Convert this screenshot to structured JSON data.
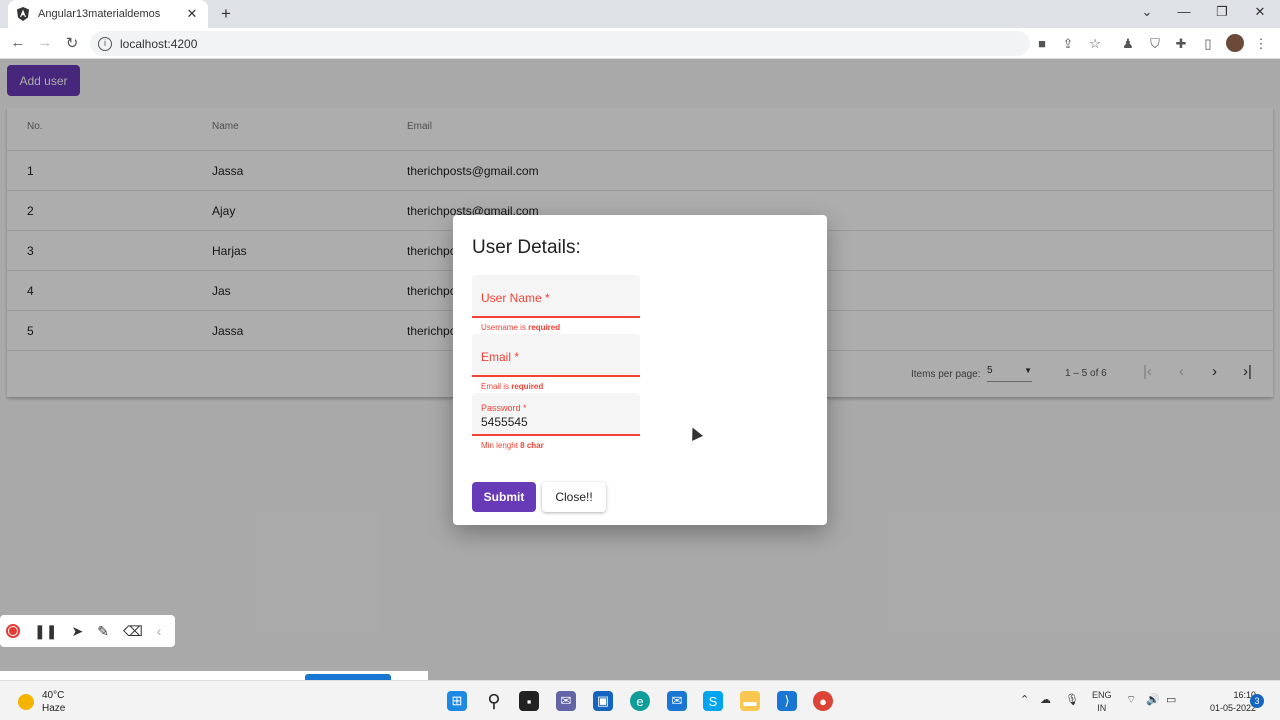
{
  "browser": {
    "tab_title": "Angular13materialdemos",
    "url": "localhost:4200"
  },
  "page": {
    "add_user_label": "Add user",
    "columns": [
      "No.",
      "Name",
      "Email"
    ],
    "rows": [
      {
        "no": "1",
        "name": "Jassa",
        "email": "therichposts@gmail.com"
      },
      {
        "no": "2",
        "name": "Ajay",
        "email": "therichposts@gmail.com"
      },
      {
        "no": "3",
        "name": "Harjas",
        "email": "therichpc"
      },
      {
        "no": "4",
        "name": "Jas",
        "email": "therichpc"
      },
      {
        "no": "5",
        "name": "Jassa",
        "email": "therichpc"
      }
    ],
    "paginator": {
      "items_per_page_label": "Items per page:",
      "page_size": "5",
      "range": "1 – 5 of 6"
    }
  },
  "dialog": {
    "title": "User Details:",
    "username_label": "User Name *",
    "username_error_prefix": "Username is ",
    "username_error_bold": "required",
    "email_label": "Email *",
    "email_error_prefix": "Email is ",
    "email_error_bold": "required",
    "password_label": "Password *",
    "password_value": "5455545",
    "password_error_prefix": "Min lenght ",
    "password_error_bold": "8 char",
    "submit_label": "Submit",
    "close_label": "Close!!"
  },
  "taskbar": {
    "temperature": "40°C",
    "weather": "Haze",
    "lang_top": "ENG",
    "lang_bottom": "IN",
    "time": "16:10",
    "date": "01-05-2022",
    "notifications": "3"
  },
  "colors": {
    "accent": "#673ab7",
    "error": "#f44336"
  }
}
